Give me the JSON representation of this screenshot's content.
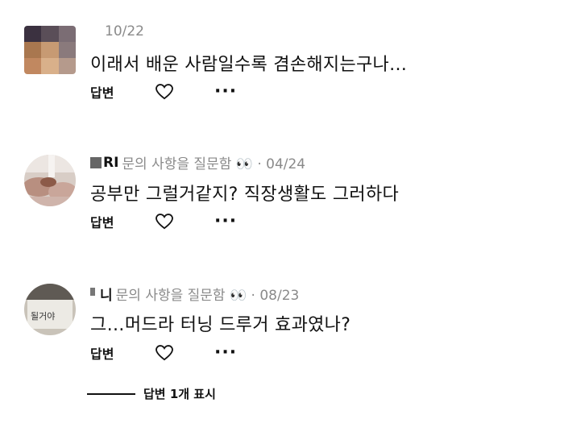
{
  "comments": [
    {
      "user": "",
      "meta": "10/22",
      "text": "이래서 배운 사람일수록 겸손해지는구나…",
      "reply_label": "답변",
      "more_label": "···"
    },
    {
      "user": "RI",
      "meta": "문의 사항을 질문함 👀 · 04/24",
      "text": "공부만 그럴거같지? 직장생활도 그러하다",
      "reply_label": "답변",
      "more_label": "···"
    },
    {
      "user": "니",
      "meta": "문의 사항을 질문함 👀 · 08/23",
      "text": "그…머드라 터닝 드루거 효과였나?",
      "reply_label": "답변",
      "more_label": "···",
      "avatar_text": "될거야"
    }
  ],
  "show_replies_label": "답변 1개 표시",
  "colors": {
    "meta": "#8a8a8a",
    "text": "#111111",
    "background": "#ffffff"
  },
  "icons": {
    "like": "heart-outline-icon",
    "more": "ellipsis-icon"
  }
}
